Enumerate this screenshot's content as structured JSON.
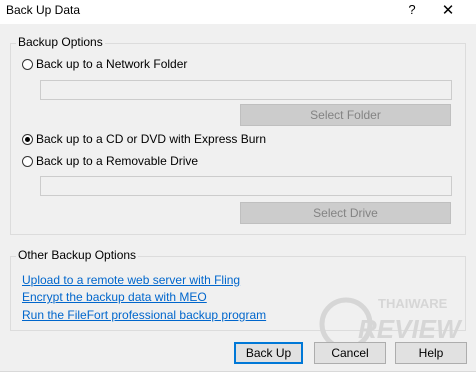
{
  "window": {
    "title": "Back Up Data",
    "help_symbol": "?",
    "close_symbol": "✕"
  },
  "backup_options": {
    "legend": "Backup Options",
    "network": {
      "label": "Back up to a Network Folder",
      "checked": false,
      "path_value": "",
      "button_label": "Select Folder"
    },
    "cd_dvd": {
      "label": "Back up to a CD or DVD with Express Burn",
      "checked": true
    },
    "removable": {
      "label": "Back up to a Removable Drive",
      "checked": false,
      "path_value": "",
      "button_label": "Select Drive"
    }
  },
  "other_options": {
    "legend": "Other Backup Options",
    "links": [
      "Upload to a remote web server with Fling",
      "Encrypt the backup data with MEO",
      "Run the FileFort professional backup program"
    ]
  },
  "buttons": {
    "backup": "Back Up",
    "cancel": "Cancel",
    "help": "Help"
  },
  "watermark": {
    "line1": "THAIWARE",
    "line2": "REVIEW"
  },
  "colors": {
    "link": "#0066cc",
    "focus": "#0078d7",
    "watermark": "#d6d6d6"
  }
}
